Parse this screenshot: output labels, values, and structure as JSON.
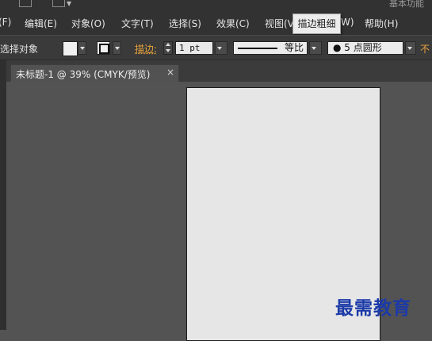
{
  "app": {
    "workspace_label": "基本功能"
  },
  "menubar": {
    "items": [
      {
        "label": "(F)"
      },
      {
        "label": "编辑(E)"
      },
      {
        "label": "对象(O)"
      },
      {
        "label": "文字(T)"
      },
      {
        "label": "选择(S)"
      },
      {
        "label": "效果(C)"
      },
      {
        "label": "视图(V"
      },
      {
        "label": "W)"
      },
      {
        "label": "帮助(H)"
      }
    ]
  },
  "tooltip": {
    "text": "描边粗细"
  },
  "control_bar": {
    "selection_label": "选择对象",
    "stroke_label": "描边:",
    "stroke_weight": "1 pt",
    "profile_label": "等比",
    "brush_label": "● 5 点圆形",
    "opacity_label": "不"
  },
  "document_tab": {
    "title": "未标题-1 @ 39% (CMYK/预览)",
    "close_glyph": "×"
  },
  "watermark": {
    "text": "最需教育"
  },
  "colors": {
    "accent_orange": "#e8a33c",
    "menubar_bg": "#323232",
    "canvas_bg": "#535353",
    "artboard_bg": "#e6e6e6",
    "watermark_blue": "#1c3aa8"
  }
}
